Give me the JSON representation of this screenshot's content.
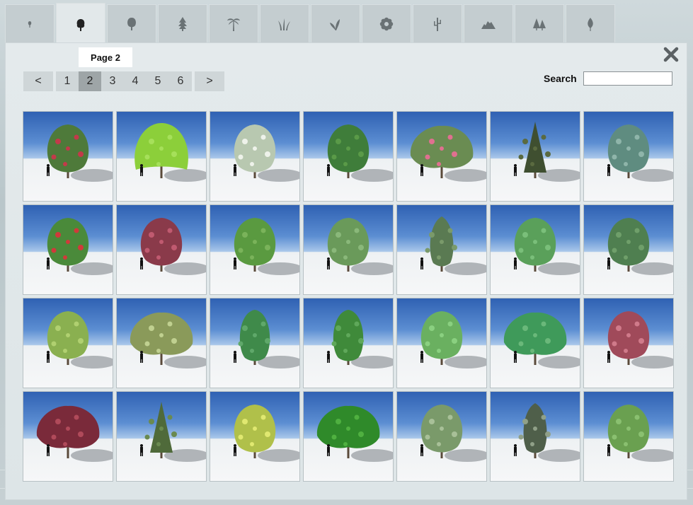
{
  "tabs": [
    {
      "icon": "small-tree-icon",
      "active": false
    },
    {
      "icon": "deciduous-tree-icon",
      "active": true
    },
    {
      "icon": "round-tree-icon",
      "active": false
    },
    {
      "icon": "conifer-icon",
      "active": false
    },
    {
      "icon": "palm-tree-icon",
      "active": false
    },
    {
      "icon": "grass-icon",
      "active": false
    },
    {
      "icon": "plant-icon",
      "active": false
    },
    {
      "icon": "flower-icon",
      "active": false
    },
    {
      "icon": "cactus-icon",
      "active": false
    },
    {
      "icon": "rock-icon",
      "active": false
    },
    {
      "icon": "forest-icon",
      "active": false
    },
    {
      "icon": "leaf-icon",
      "active": false
    }
  ],
  "page_label": "Page 2",
  "pager": {
    "prev": "<",
    "next": ">",
    "pages": [
      "1",
      "2",
      "3",
      "4",
      "5",
      "6"
    ],
    "selected": "2"
  },
  "search": {
    "label": "Search",
    "value": ""
  },
  "grid": {
    "items": [
      {
        "foliage": "#4e7a3a",
        "accent": "#c23a4a",
        "shape": "round"
      },
      {
        "foliage": "#8ccf3a",
        "accent": "#a6e05a",
        "shape": "weeping"
      },
      {
        "foliage": "#b8c8b0",
        "accent": "#eef2ea",
        "shape": "round"
      },
      {
        "foliage": "#3f7d3a",
        "accent": "#5a9a48",
        "shape": "round"
      },
      {
        "foliage": "#6a8c52",
        "accent": "#e07090",
        "shape": "wide"
      },
      {
        "foliage": "#3f4f30",
        "accent": "#5a6a40",
        "shape": "conical"
      },
      {
        "foliage": "#5f8c80",
        "accent": "#8fb5aa",
        "shape": "round"
      },
      {
        "foliage": "#4a8a3a",
        "accent": "#d03a3a",
        "shape": "round"
      },
      {
        "foliage": "#8a3a4a",
        "accent": "#c05a70",
        "shape": "round"
      },
      {
        "foliage": "#5a9a40",
        "accent": "#7ab35a",
        "shape": "round"
      },
      {
        "foliage": "#6a9a5a",
        "accent": "#8ab87a",
        "shape": "round"
      },
      {
        "foliage": "#5a7a52",
        "accent": "#7a9a6a",
        "shape": "narrow"
      },
      {
        "foliage": "#5aa05a",
        "accent": "#7abf7a",
        "shape": "round"
      },
      {
        "foliage": "#4f7f50",
        "accent": "#6f9f6a",
        "shape": "round"
      },
      {
        "foliage": "#8ab050",
        "accent": "#b0d070",
        "shape": "round"
      },
      {
        "foliage": "#8a9a5a",
        "accent": "#c0d090",
        "shape": "wide"
      },
      {
        "foliage": "#3f8a4a",
        "accent": "#5fa86a",
        "shape": "oval"
      },
      {
        "foliage": "#3f8a3a",
        "accent": "#5fa85a",
        "shape": "oval"
      },
      {
        "foliage": "#6ab060",
        "accent": "#8ad080",
        "shape": "round"
      },
      {
        "foliage": "#3f9a5a",
        "accent": "#6ab87a",
        "shape": "wide"
      },
      {
        "foliage": "#a04a5a",
        "accent": "#d07a8a",
        "shape": "round"
      },
      {
        "foliage": "#7a2a3a",
        "accent": "#b04a5a",
        "shape": "wide"
      },
      {
        "foliage": "#4f6a3a",
        "accent": "#6a8a50",
        "shape": "conical"
      },
      {
        "foliage": "#b0c04a",
        "accent": "#e0e870",
        "shape": "round"
      },
      {
        "foliage": "#2f8a2a",
        "accent": "#4fb040",
        "shape": "wide"
      },
      {
        "foliage": "#7a9a6a",
        "accent": "#a8c098",
        "shape": "round"
      },
      {
        "foliage": "#4f5f4a",
        "accent": "#90a088",
        "shape": "narrow"
      },
      {
        "foliage": "#6aa050",
        "accent": "#8ac070",
        "shape": "round"
      }
    ]
  }
}
